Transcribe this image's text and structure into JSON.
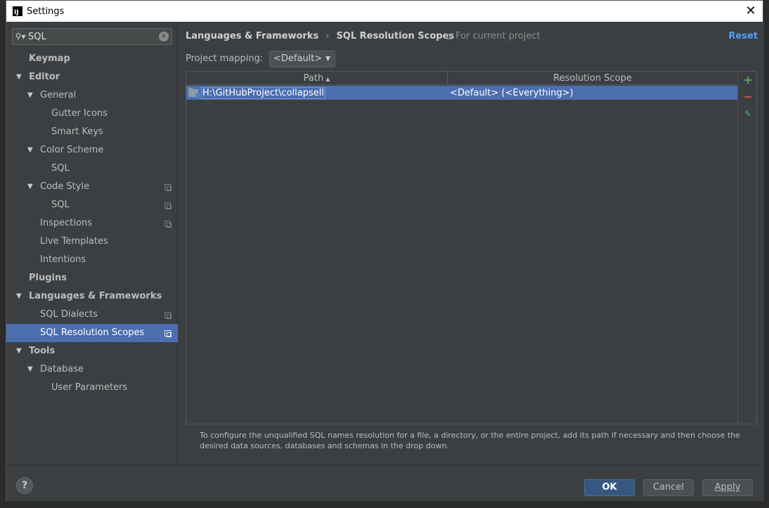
{
  "window": {
    "title": "Settings"
  },
  "search": {
    "value": "SQL"
  },
  "tree": [
    {
      "label": "Keymap",
      "level": 0,
      "bold": true,
      "arrow": "",
      "proj": false,
      "selected": false
    },
    {
      "label": "Editor",
      "level": 0,
      "bold": true,
      "arrow": "▼",
      "proj": false,
      "selected": false
    },
    {
      "label": "General",
      "level": 1,
      "bold": false,
      "arrow": "▼",
      "proj": false,
      "selected": false
    },
    {
      "label": "Gutter Icons",
      "level": 2,
      "bold": false,
      "arrow": "",
      "proj": false,
      "selected": false
    },
    {
      "label": "Smart Keys",
      "level": 2,
      "bold": false,
      "arrow": "",
      "proj": false,
      "selected": false
    },
    {
      "label": "Color Scheme",
      "level": 1,
      "bold": false,
      "arrow": "▼",
      "proj": false,
      "selected": false
    },
    {
      "label": "SQL",
      "level": 2,
      "bold": false,
      "arrow": "",
      "proj": false,
      "selected": false
    },
    {
      "label": "Code Style",
      "level": 1,
      "bold": false,
      "arrow": "▼",
      "proj": true,
      "selected": false
    },
    {
      "label": "SQL",
      "level": 2,
      "bold": false,
      "arrow": "",
      "proj": true,
      "selected": false
    },
    {
      "label": "Inspections",
      "level": 1,
      "bold": false,
      "arrow": "",
      "proj": true,
      "selected": false
    },
    {
      "label": "Live Templates",
      "level": 1,
      "bold": false,
      "arrow": "",
      "proj": false,
      "selected": false
    },
    {
      "label": "Intentions",
      "level": 1,
      "bold": false,
      "arrow": "",
      "proj": false,
      "selected": false
    },
    {
      "label": "Plugins",
      "level": 0,
      "bold": true,
      "arrow": "",
      "proj": false,
      "selected": false
    },
    {
      "label": "Languages & Frameworks",
      "level": 0,
      "bold": true,
      "arrow": "▼",
      "proj": false,
      "selected": false
    },
    {
      "label": "SQL Dialects",
      "level": 1,
      "bold": false,
      "arrow": "",
      "proj": true,
      "selected": false
    },
    {
      "label": "SQL Resolution Scopes",
      "level": 1,
      "bold": false,
      "arrow": "",
      "proj": true,
      "selected": true
    },
    {
      "label": "Tools",
      "level": 0,
      "bold": true,
      "arrow": "▼",
      "proj": false,
      "selected": false
    },
    {
      "label": "Database",
      "level": 1,
      "bold": false,
      "arrow": "▼",
      "proj": false,
      "selected": false
    },
    {
      "label": "User Parameters",
      "level": 2,
      "bold": false,
      "arrow": "",
      "proj": false,
      "selected": false
    }
  ],
  "main": {
    "breadcrumb_parent": "Languages & Frameworks",
    "breadcrumb_sep": "›",
    "breadcrumb_current": "SQL Resolution Scopes",
    "for_current_project": "For current project",
    "reset": "Reset",
    "project_mapping_label": "Project mapping:",
    "project_mapping_value": "<Default>",
    "table": {
      "columns": [
        "Path",
        "Resolution Scope"
      ],
      "sort_indicator": "▲",
      "rows": [
        {
          "path": "H:\\GitHubProject\\collapsell",
          "scope": "<Default> (<Everything>)"
        }
      ]
    },
    "note": "To configure the unqualified SQL names resolution for a file, a directory, or the entire project, add its path if necessary and then choose the desired data sources, databases and schemas in the drop down."
  },
  "footer": {
    "help": "?",
    "ok": "OK",
    "cancel": "Cancel",
    "apply": "Apply"
  },
  "colors": {
    "selection": "#4b6eaf",
    "link": "#589df6",
    "add": "#59a869",
    "remove": "#c75450"
  }
}
